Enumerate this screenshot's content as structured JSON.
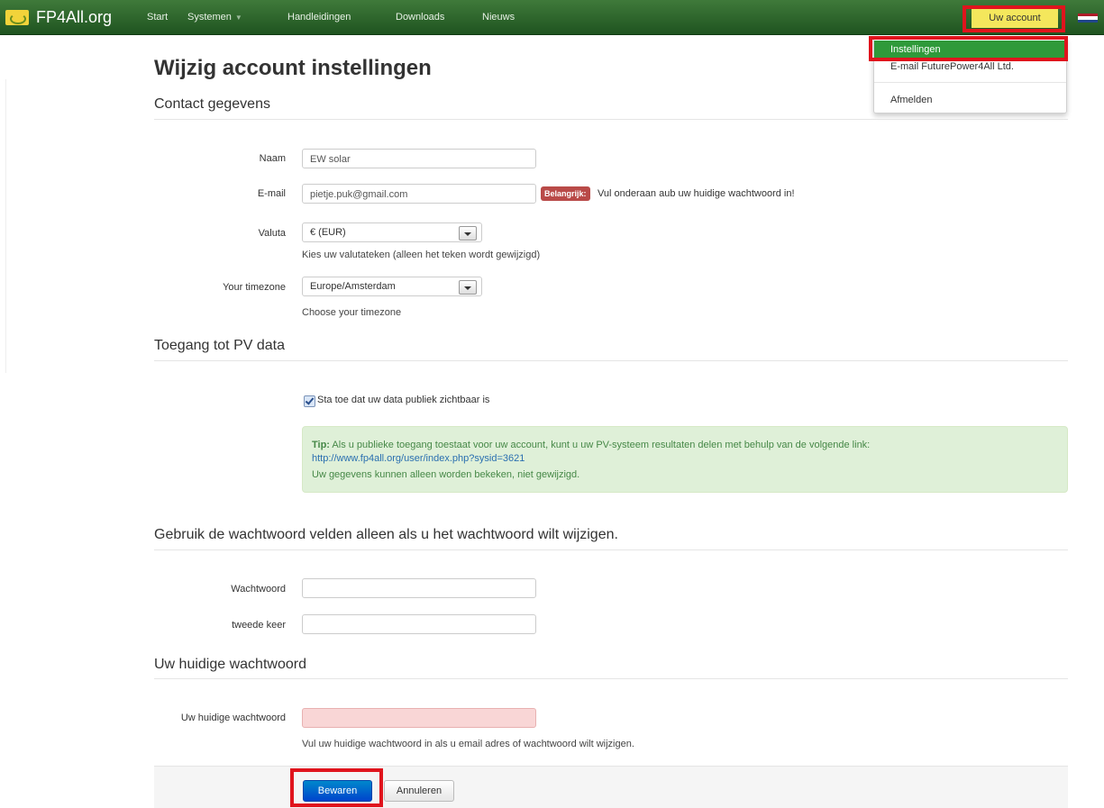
{
  "navbar": {
    "brand": "FP4All.org",
    "items": [
      {
        "label": "Start"
      },
      {
        "label": "Systemen"
      },
      {
        "label": "Handleidingen"
      },
      {
        "label": "Downloads"
      },
      {
        "label": "Nieuws"
      }
    ],
    "account_label": "Uw account",
    "brand_color": "#2f6b2c",
    "account_color": "#f4e75c"
  },
  "dropdown": {
    "items": [
      {
        "label": "Instellingen",
        "active": true
      },
      {
        "label": "E-mail FuturePower4All Ltd."
      },
      {
        "label": "Afmelden"
      }
    ]
  },
  "page": {
    "title": "Wijzig account instellingen"
  },
  "contact": {
    "legend": "Contact gegevens",
    "name_label": "Naam",
    "name_value": "EW solar",
    "email_label": "E-mail",
    "email_value": "pietje.puk@gmail.com",
    "badge": "Belangrijk:",
    "badge_text": "Vul onderaan aub uw huidige wachtwoord in!",
    "currency_label": "Valuta",
    "currency_value": "€ (EUR)",
    "currency_help": "Kies uw valutateken (alleen het teken wordt gewijzigd)",
    "timezone_label": "Your timezone",
    "timezone_value": "Europe/Amsterdam",
    "timezone_help": "Choose your timezone"
  },
  "pv": {
    "legend": "Toegang tot PV data",
    "checkbox_label": "Sta toe dat uw data publiek zichtbaar is",
    "checked": true,
    "tip_label": "Tip:",
    "tip_text": "Als u publieke toegang toestaat voor uw account, kunt u uw PV-systeem resultaten delen met behulp van de volgende link:",
    "tip_link": "http://www.fp4all.org/user/index.php?sysid=3621",
    "tip_note": "Uw gegevens kunnen alleen worden bekeken, niet gewijzigd."
  },
  "password": {
    "legend": "Gebruik de wachtwoord velden alleen als u het wachtwoord wilt wijzigen.",
    "pw_label": "Wachtwoord",
    "pw2_label": "tweede keer"
  },
  "current": {
    "legend": "Uw huidige wachtwoord",
    "label": "Uw huidige wachtwoord",
    "help": "Vul uw huidige wachtwoord in als u email adres of wachtwoord wilt wijzigen."
  },
  "actions": {
    "save": "Bewaren",
    "cancel": "Annuleren"
  }
}
